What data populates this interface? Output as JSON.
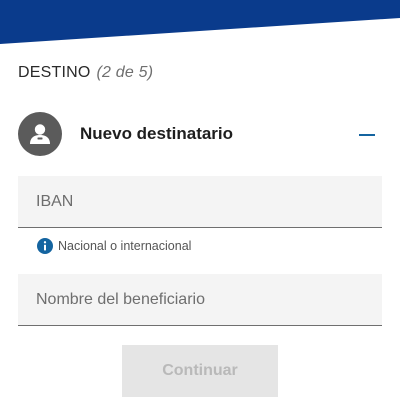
{
  "colors": {
    "brand_band": "#0a3b8c",
    "accent": "#1464a0",
    "info_icon": "#1464a0",
    "avatar_bg": "#5b5b5b",
    "field_bg": "#f4f4f4",
    "button_disabled_bg": "#e5e5e5",
    "button_disabled_text": "#b9b9b9"
  },
  "step": {
    "title": "DESTINO",
    "progress": "(2 de 5)"
  },
  "recipient": {
    "avatar_icon": "user-icon",
    "title": "Nuevo destinatario",
    "collapse_icon": "minus-icon"
  },
  "form": {
    "iban": {
      "placeholder": "IBAN",
      "value": ""
    },
    "hint": {
      "icon": "info-icon",
      "text": "Nacional o internacional"
    },
    "beneficiary": {
      "placeholder": "Nombre del beneficiario",
      "value": ""
    }
  },
  "actions": {
    "continue_label": "Continuar",
    "continue_enabled": false
  }
}
